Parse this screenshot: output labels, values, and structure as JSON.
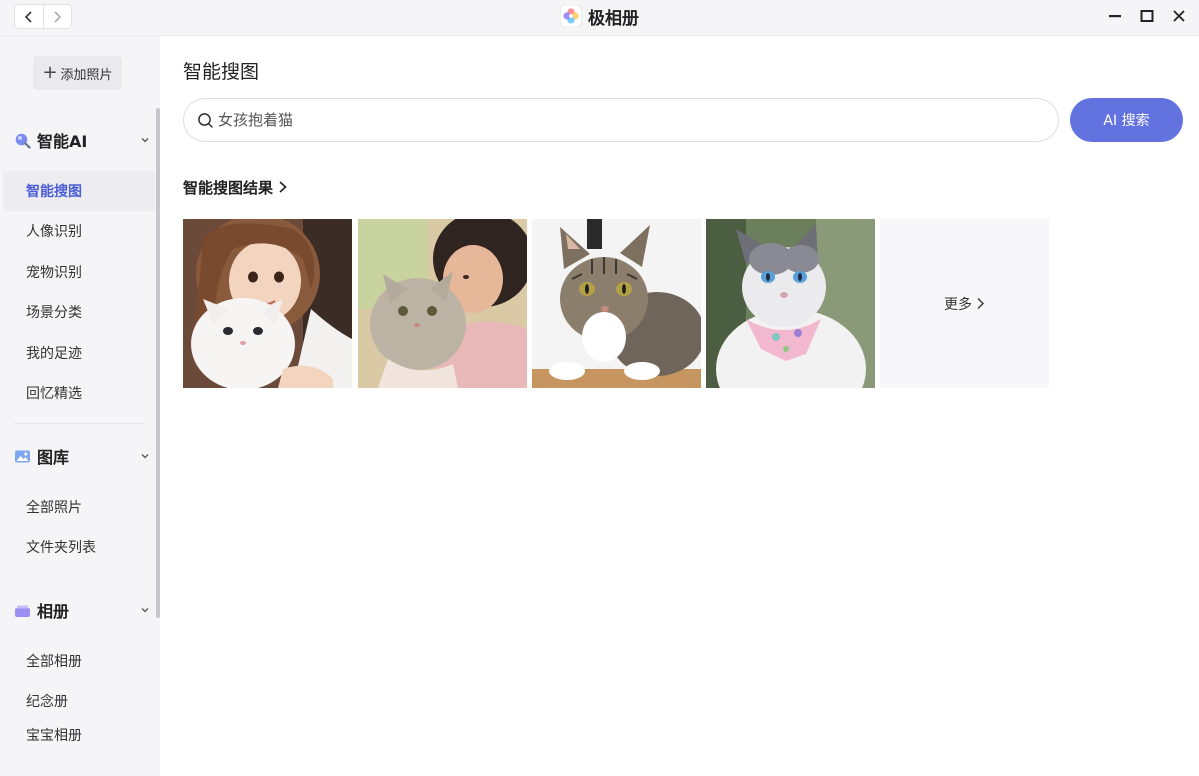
{
  "app": {
    "title": "极相册"
  },
  "sidebar": {
    "add_photo_label": "添加照片",
    "sections": [
      {
        "label": "智能AI",
        "icon": "ai-search-icon",
        "items": [
          "智能搜图",
          "人像识别",
          "宠物识别",
          "场景分类",
          "我的足迹",
          "回忆精选"
        ]
      },
      {
        "label": "图库",
        "icon": "image-library-icon",
        "items": [
          "全部照片",
          "文件夹列表"
        ]
      },
      {
        "label": "相册",
        "icon": "album-icon",
        "items": [
          "全部相册",
          "纪念册",
          "宝宝相册"
        ]
      }
    ],
    "active_item": "智能搜图"
  },
  "main": {
    "page_title": "智能搜图",
    "search": {
      "value": "",
      "placeholder": "女孩抱着猫",
      "button_label": "AI 搜索"
    },
    "results": {
      "label": "智能搜图结果",
      "images": [
        "girl-hugging-white-kitten",
        "child-hugging-grey-cat",
        "tabby-cat-lying",
        "ragdoll-cat-with-bandana"
      ],
      "more_label": "更多"
    }
  },
  "colors": {
    "accent": "#6272de",
    "active_text": "#4d5fd6",
    "sidebar_bg": "#f5f5f7"
  }
}
